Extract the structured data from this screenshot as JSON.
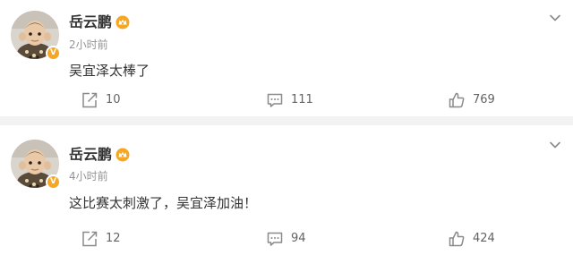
{
  "posts": [
    {
      "author": "岳云鹏",
      "time": "2小时前",
      "content": "吴宜泽太棒了",
      "reposts": "10",
      "comments": "111",
      "likes": "769"
    },
    {
      "author": "岳云鹏",
      "time": "4小时前",
      "content": "这比赛太刺激了，吴宜泽加油！",
      "reposts": "12",
      "comments": "94",
      "likes": "424"
    }
  ],
  "colors": {
    "verified_badge": "#f5a623",
    "member_icon": "#f5a623",
    "muted_text": "#939393",
    "action_text": "#636363",
    "divider": "#f2f2f2"
  },
  "icons": {
    "repost": "repost-icon",
    "comment": "comment-icon",
    "like": "like-icon",
    "more": "chevron-down-icon",
    "verified": "verified-icon",
    "member": "member-crown-icon"
  }
}
